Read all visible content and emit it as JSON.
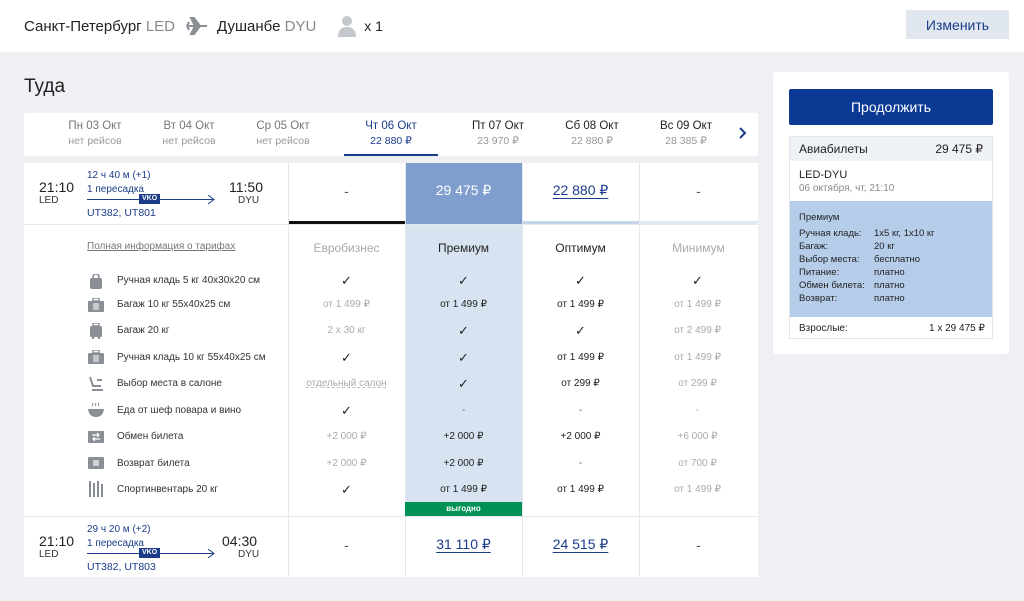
{
  "header": {
    "from_city": "Санкт-Петербург",
    "from_code": "LED",
    "to_city": "Душанбе",
    "to_code": "DYU",
    "passengers": "x 1",
    "change_label": "Изменить"
  },
  "direction_title": "Туда",
  "dates": [
    {
      "day": "Пн 03 Окт",
      "price": "нет рейсов"
    },
    {
      "day": "Вт 04 Окт",
      "price": "нет рейсов"
    },
    {
      "day": "Ср 05 Окт",
      "price": "нет рейсов"
    },
    {
      "day": "Чт 06 Окт",
      "price": "22 880 ₽"
    },
    {
      "day": "Пт 07 Окт",
      "price": "23 970 ₽"
    },
    {
      "day": "Сб 08 Окт",
      "price": "22 880 ₽"
    },
    {
      "day": "Вс 09 Окт",
      "price": "28 385 ₽"
    }
  ],
  "flights": [
    {
      "dep_time": "21:10",
      "dep_code": "LED",
      "arr_time": "11:50",
      "arr_code": "DYU",
      "duration": "12 ч 40 м (+1)",
      "stops": "1 пересадка",
      "via": "VKO",
      "numbers": "UT382, UT801",
      "prices": [
        "-",
        "29 475 ₽",
        "22 880 ₽",
        "-"
      ]
    },
    {
      "dep_time": "21:10",
      "dep_code": "LED",
      "arr_time": "04:30",
      "arr_code": "DYU",
      "duration": "29 ч 20 м (+2)",
      "stops": "1 пересадка",
      "via": "VKO",
      "numbers": "UT382, UT803",
      "prices": [
        "-",
        "31 110 ₽",
        "24 515 ₽",
        "-"
      ]
    }
  ],
  "tariffs": {
    "info_link": "Полная информация о тарифах",
    "columns": [
      "Евробизнес",
      "Премиум",
      "Оптимум",
      "Минимум"
    ],
    "badge": "выгодно",
    "rows": [
      {
        "icon": "handbag-icon",
        "label": "Ручная кладь 5 кг 40x30x20 см",
        "values": [
          "✓",
          "✓",
          "✓",
          "✓"
        ]
      },
      {
        "icon": "baggage-icon",
        "label": "Багаж 10 кг 55x40x25 см",
        "values": [
          "от 1 499 ₽",
          "от 1 499 ₽",
          "от 1 499 ₽",
          "от 1 499 ₽"
        ]
      },
      {
        "icon": "suitcase-icon",
        "label": "Багаж 20 кг",
        "values": [
          "2 x 30 кг",
          "✓",
          "✓",
          "от 2 499 ₽"
        ]
      },
      {
        "icon": "carry-on-icon",
        "label": "Ручная кладь 10 кг 55x40x25 см",
        "values": [
          "✓",
          "✓",
          "от 1 499 ₽",
          "от 1 499 ₽"
        ]
      },
      {
        "icon": "seat-icon",
        "label": "Выбор места в салоне",
        "values": [
          "отдельный салон",
          "✓",
          "от 299 ₽",
          "от 299 ₽"
        ]
      },
      {
        "icon": "meal-icon",
        "label": "Еда от шеф повара и вино",
        "values": [
          "✓",
          "-",
          "-",
          "-"
        ]
      },
      {
        "icon": "exchange-icon",
        "label": "Обмен билета",
        "values": [
          "+2 000 ₽",
          "+2 000 ₽",
          "+2 000 ₽",
          "+6 000 ₽"
        ]
      },
      {
        "icon": "refund-icon",
        "label": "Возврат билета",
        "values": [
          "+2 000 ₽",
          "+2 000 ₽",
          "-",
          "от 700 ₽"
        ]
      },
      {
        "icon": "sports-icon",
        "label": "Спортинвентарь 20 кг",
        "values": [
          "✓",
          "от 1 499 ₽",
          "от 1 499 ₽",
          "от 1 499 ₽"
        ]
      }
    ]
  },
  "summary": {
    "continue_label": "Продолжить",
    "tickets_label": "Авиабилеты",
    "tickets_price": "29 475 ₽",
    "route": "LED-DYU",
    "date": "06 октября, чт, 21:10",
    "tariff_name": "Премиум",
    "details": [
      {
        "label": "Ручная кладь:",
        "value": "1x5 кг, 1x10 кг"
      },
      {
        "label": "Багаж:",
        "value": "20 кг"
      },
      {
        "label": "Выбор места:",
        "value": "бесплатно"
      },
      {
        "label": "Питание:",
        "value": "платно"
      },
      {
        "label": "Обмен билета:",
        "value": "платно"
      },
      {
        "label": "Возврат:",
        "value": "платно"
      }
    ],
    "adults_label": "Взрослые:",
    "adults_value": "1 x 29 475 ₽"
  },
  "colors": {
    "brand": "#0b3a94",
    "premium_header": "#7f9ecd",
    "premium_column": "#d7e3f1",
    "badge": "#009156"
  }
}
